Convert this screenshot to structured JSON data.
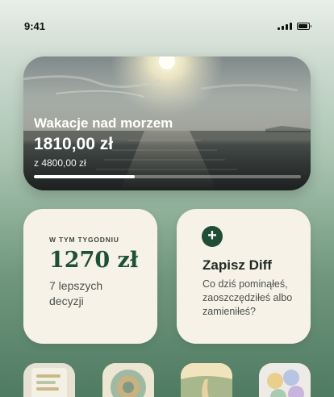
{
  "status_bar": {
    "time": "9:41"
  },
  "goal_card": {
    "title": "Wakacje nad morzem",
    "saved": "1810,00 zł",
    "target": "z 4800,00 zł",
    "progress": 0.377
  },
  "week_card": {
    "label": "W TYM TYGODNIU",
    "amount": "1270 zł",
    "description": "7 lepszych decyzji"
  },
  "save_diff_card": {
    "title": "Zapisz Diff",
    "description": "Co dziś pominąłeś, zaoszczędziłeś albo zamieniłeś?",
    "add_icon": "plus-icon"
  },
  "thumbnails": [
    {
      "name": "notes-thumbnail"
    },
    {
      "name": "flower-thumbnail"
    },
    {
      "name": "road-thumbnail"
    },
    {
      "name": "petals-thumbnail"
    }
  ]
}
